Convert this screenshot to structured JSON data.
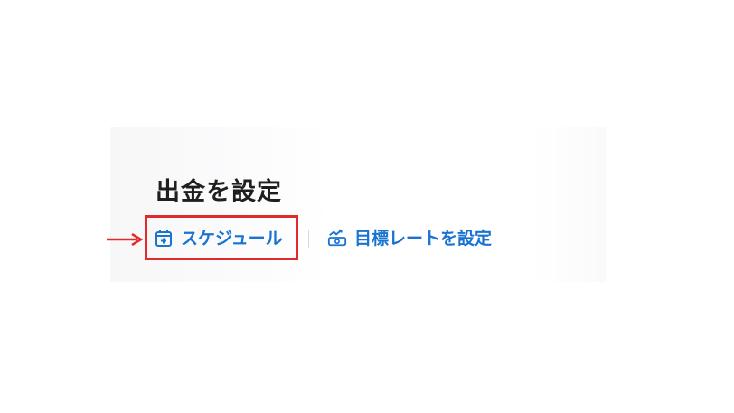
{
  "page": {
    "title": "出金を設定"
  },
  "actions": {
    "schedule_label": "スケジュール",
    "target_rate_label": "目標レートを設定"
  },
  "icons": {
    "schedule": "calendar-plus-icon",
    "target_rate": "target-rate-icon",
    "pointer": "red-arrow-icon"
  },
  "colors": {
    "link": "#1a73d1",
    "highlight": "#e32a2a",
    "title": "#1f1f1f"
  }
}
